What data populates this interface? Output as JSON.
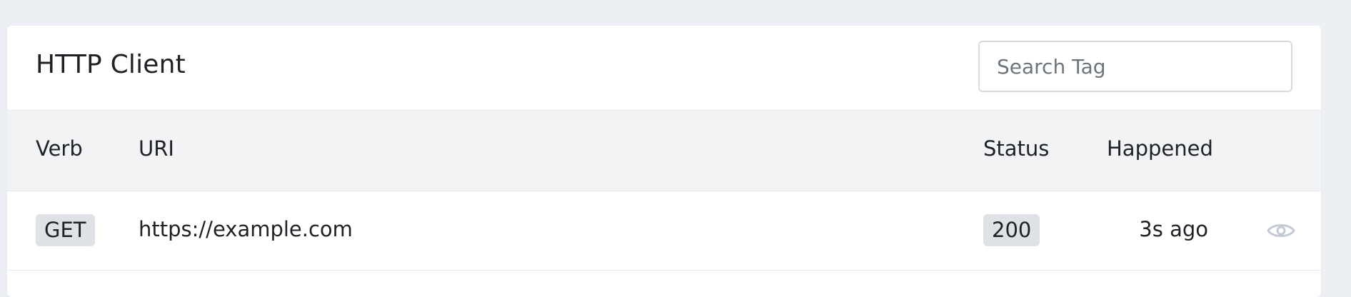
{
  "header": {
    "title": "HTTP Client",
    "search_placeholder": "Search Tag"
  },
  "table": {
    "columns": [
      "Verb",
      "URI",
      "Status",
      "Happened"
    ],
    "rows": [
      {
        "verb": "GET",
        "uri": "https://example.com",
        "status": "200",
        "happened": "3s ago",
        "action_icon": "eye-icon"
      }
    ]
  },
  "colors": {
    "page_background": "#eceff3",
    "card_background": "#ffffff",
    "table_header_background": "#f2f3f5",
    "badge_background": "#dee1e5",
    "icon_color": "#c4cad3"
  }
}
